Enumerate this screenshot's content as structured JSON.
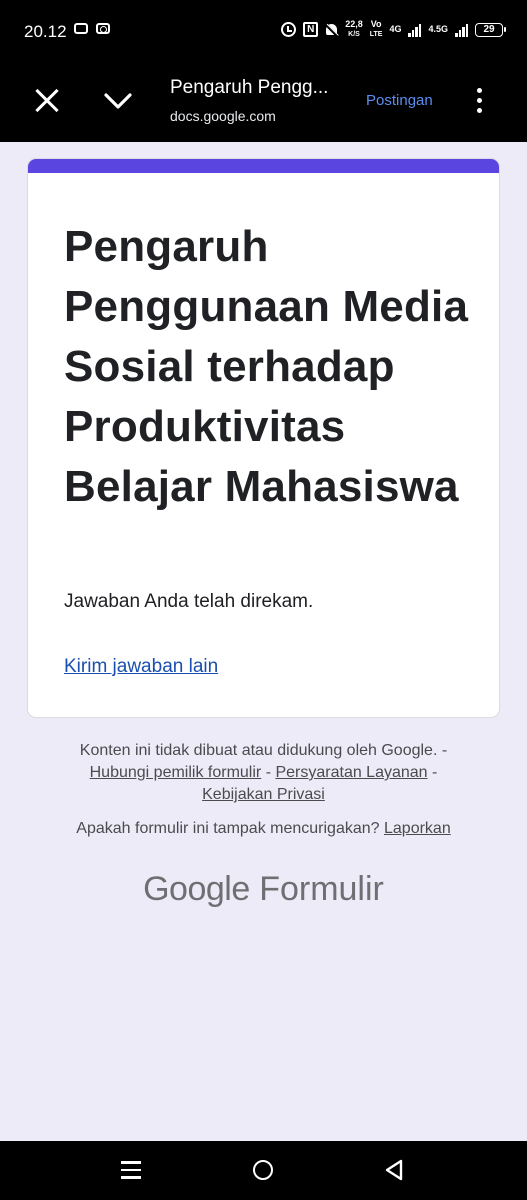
{
  "status_bar": {
    "time": "20.12",
    "speed_value": "22,8",
    "speed_unit": "K/S",
    "volte_top": "Vo",
    "volte_bottom": "LTE",
    "net1": "4G",
    "net2": "4.5G",
    "battery": "29"
  },
  "app_bar": {
    "title": "Pengaruh Pengg...",
    "url": "docs.google.com",
    "action": "Postingan"
  },
  "card": {
    "title": "Pengaruh Penggunaan Media Sosial terhadap Produktivitas Belajar Mahasiswa",
    "confirmation": "Jawaban Anda telah direkam.",
    "submit_another": "Kirim jawaban lain",
    "accent_color": "#5a45e0"
  },
  "footer": {
    "disclaimer": "Konten ini tidak dibuat atau didukung oleh Google.",
    "sep1": " -",
    "link_contact": "Hubungi pemilik formulir",
    "sep2": " - ",
    "link_terms": "Persyaratan Layanan",
    "sep3": " -",
    "link_privacy": "Kebijakan Privasi",
    "suspicious_text": "Apakah formulir ini tampak mencurigakan?",
    "report_link": "Laporkan",
    "brand_google": "Google",
    "brand_product": "Formulir"
  },
  "icons": {
    "close": "close-icon",
    "collapse": "chevron-down-icon",
    "more": "more-vert-icon",
    "nav_recents": "menu-icon",
    "nav_home": "home-icon",
    "nav_back": "back-icon"
  }
}
